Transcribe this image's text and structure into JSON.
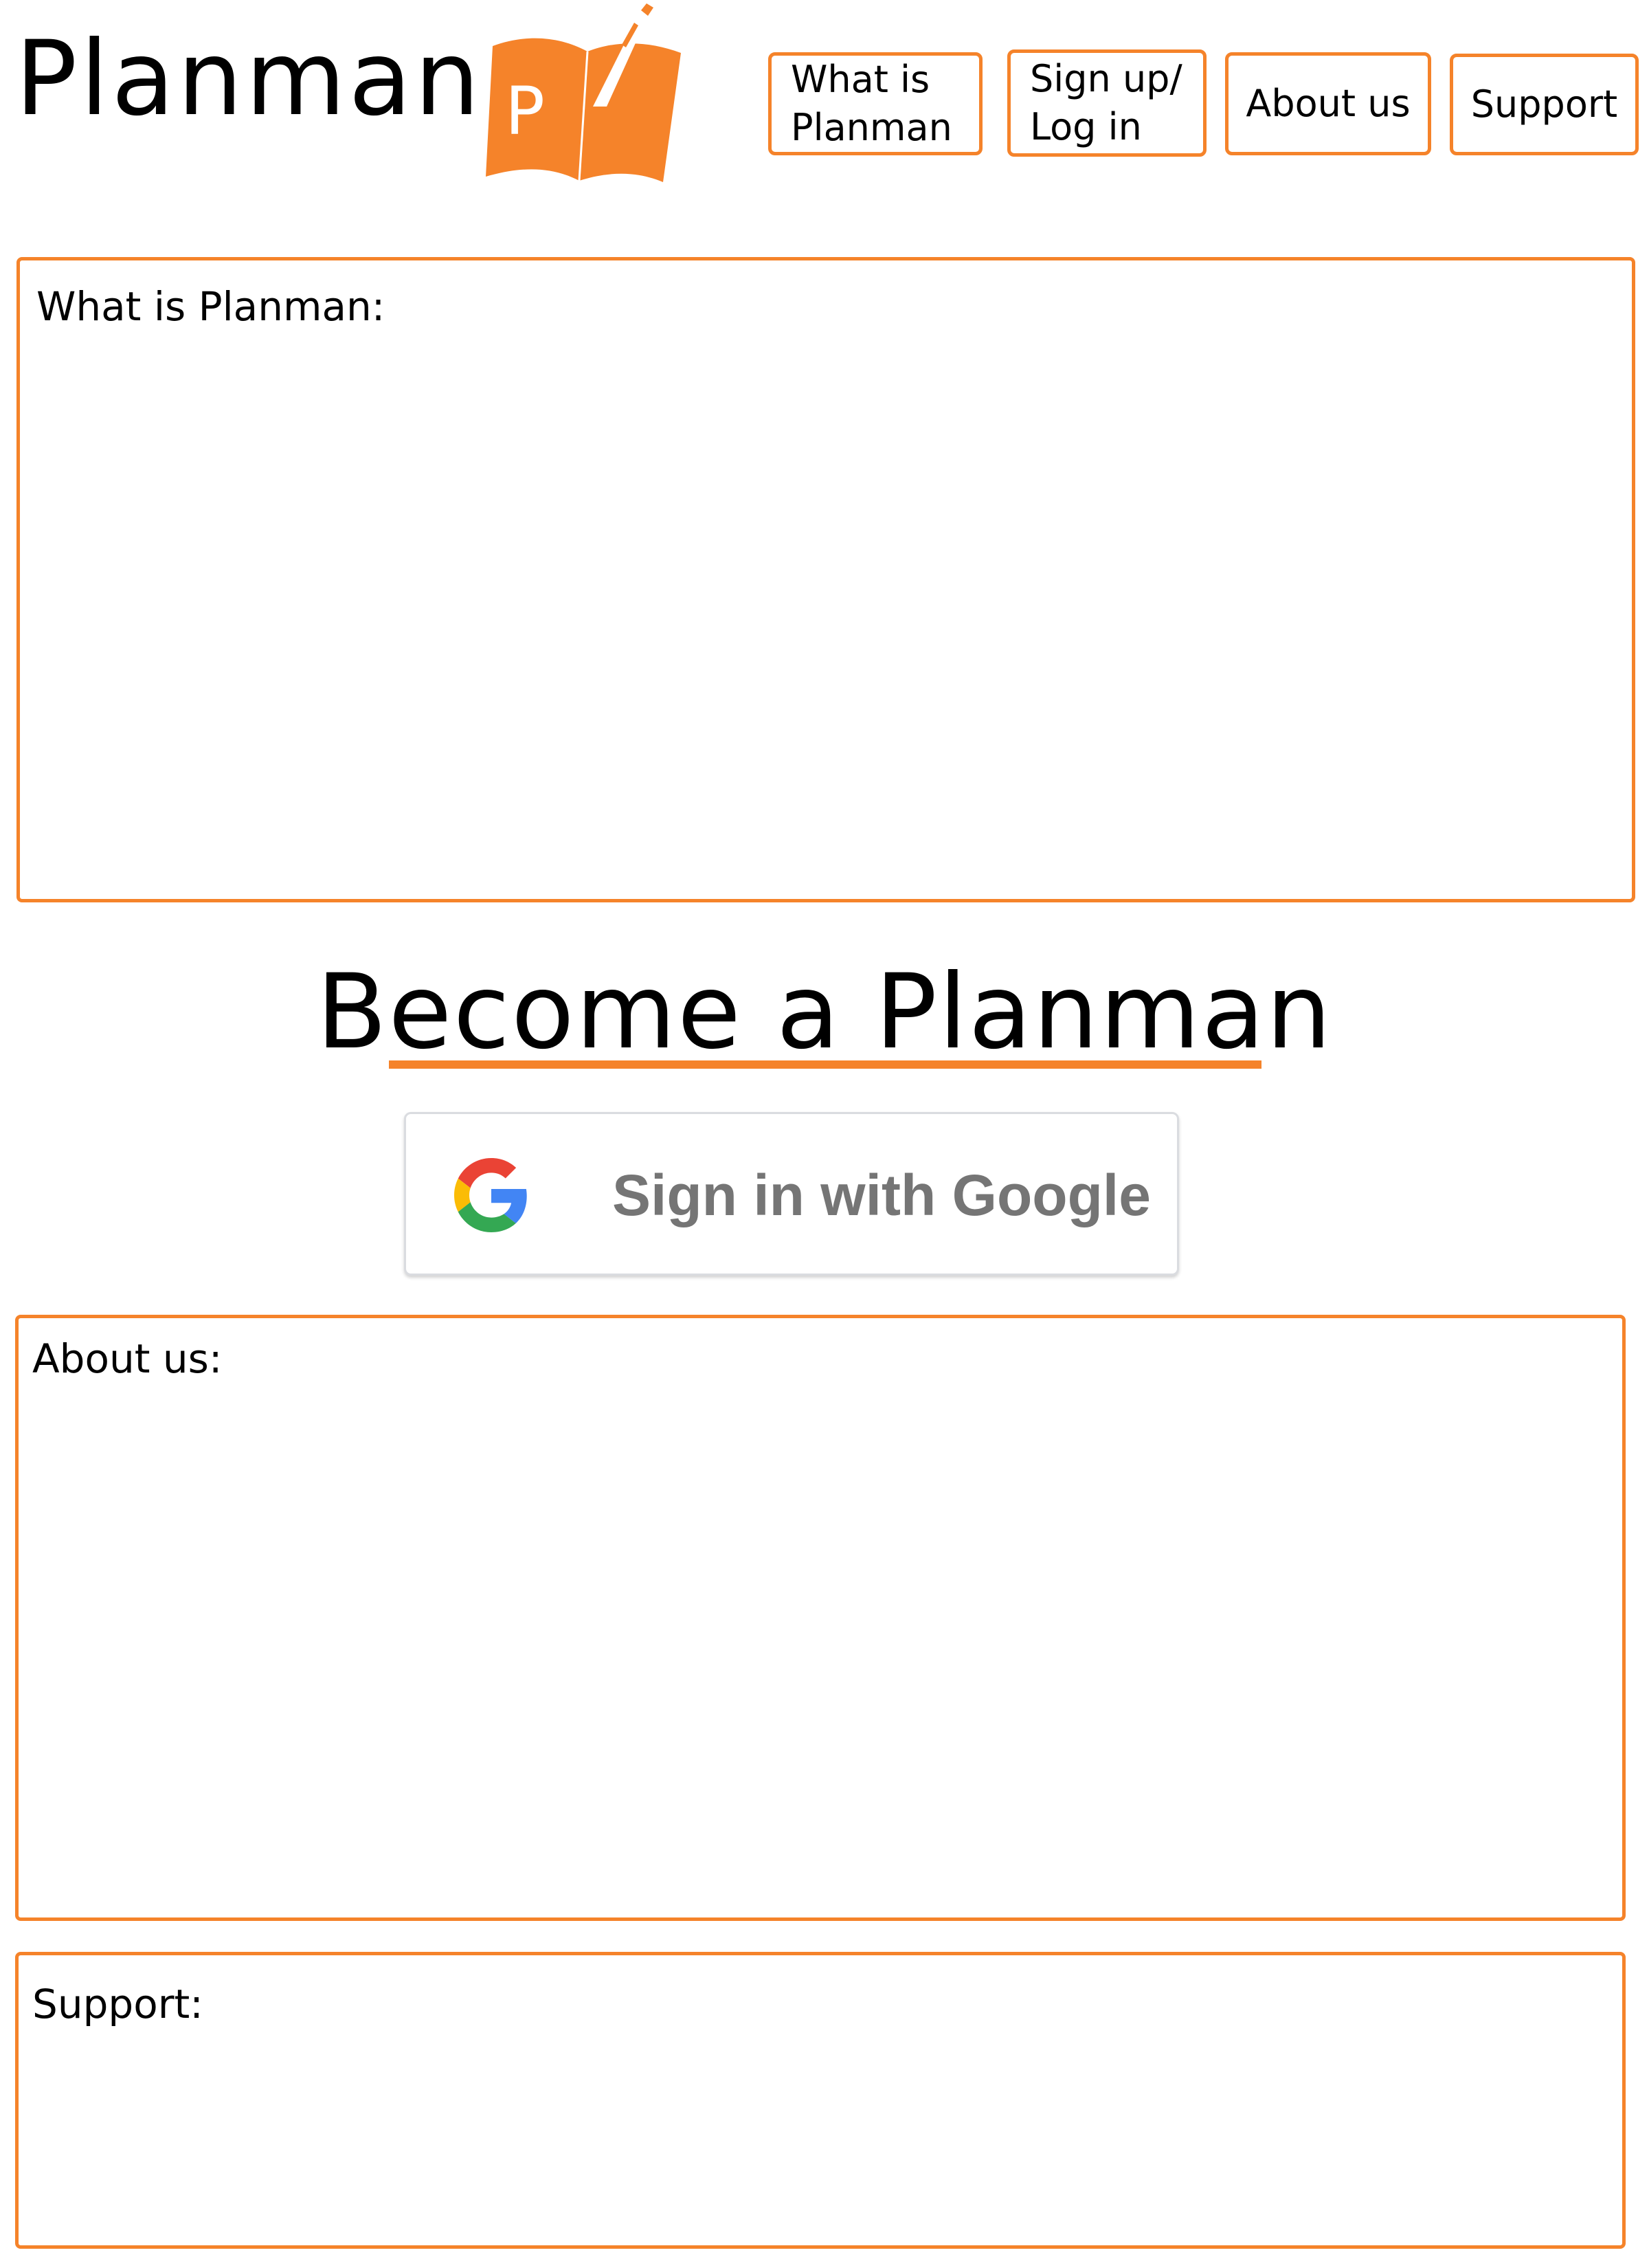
{
  "brand": {
    "title": "Planman",
    "logo_letter": "P",
    "accent_color": "#f5832a"
  },
  "nav": {
    "items": [
      {
        "label": "What is\nPlanman"
      },
      {
        "label": "Sign up/\nLog in"
      },
      {
        "label": "About us"
      },
      {
        "label": "Support"
      }
    ]
  },
  "sections": {
    "what": {
      "label": "What is Planman:"
    },
    "about": {
      "label": "About us:"
    },
    "support": {
      "label": "Support:"
    }
  },
  "cta": {
    "title": "Become a Planman",
    "google_button_label": "Sign in with Google",
    "google_icon": "google-g-icon"
  }
}
